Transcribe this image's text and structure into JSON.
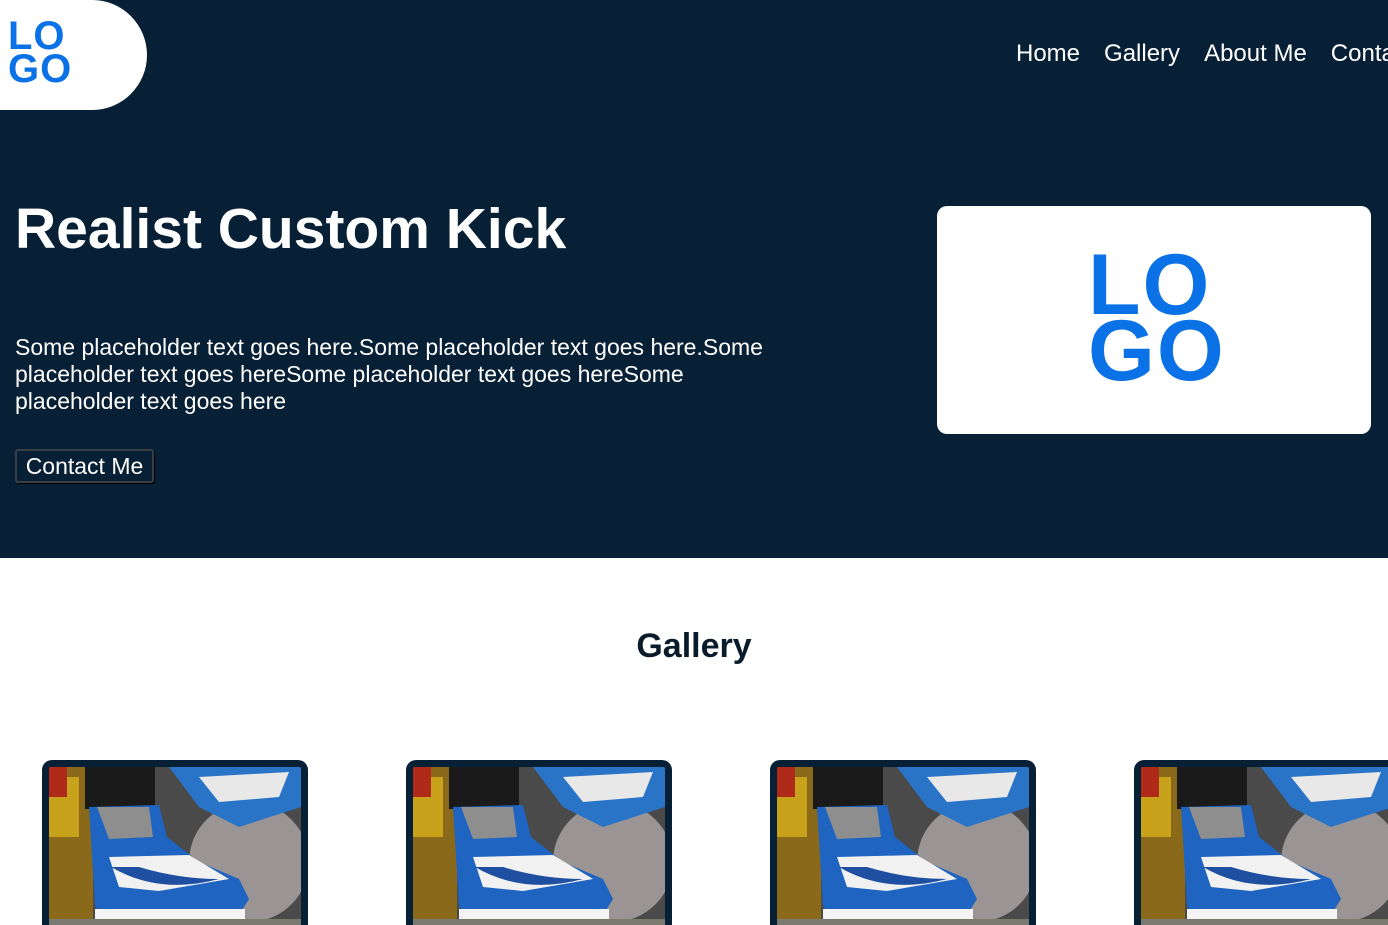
{
  "header": {
    "logo": {
      "line1": "LO",
      "line2": "GO"
    },
    "nav": [
      "Home",
      "Gallery",
      "About Me",
      "Contact"
    ]
  },
  "hero": {
    "title": "Realist Custom Kick",
    "text": "Some placeholder text goes here.Some placeholder text goes here.Some placeholder text goes hereSome placeholder text goes hereSome placeholder text goes here",
    "button_label": "Contact Me",
    "card_logo": {
      "line1": "LO",
      "line2": "GO"
    }
  },
  "gallery": {
    "title": "Gallery",
    "items": [
      {
        "image": "blue-white-sneaker-photo"
      },
      {
        "image": "blue-white-sneaker-photo"
      },
      {
        "image": "blue-white-sneaker-photo"
      },
      {
        "image": "blue-white-sneaker-photo"
      }
    ]
  },
  "colors": {
    "navy": "#072036",
    "logo_blue": "#0a72e6",
    "sneaker_blue": "#1e64c0"
  }
}
